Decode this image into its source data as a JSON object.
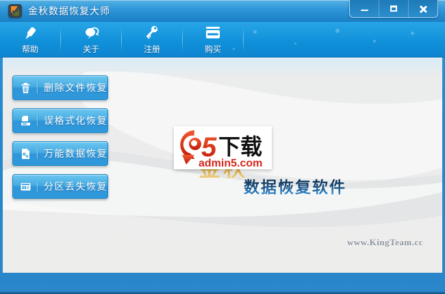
{
  "window": {
    "title": "金秋数据恢复大师",
    "controls": [
      {
        "name": "minimize"
      },
      {
        "name": "maximize"
      },
      {
        "name": "close"
      }
    ]
  },
  "toolbar": {
    "items": [
      {
        "label": "帮助",
        "icon": "pen-icon"
      },
      {
        "label": "关于",
        "icon": "chat-bubbles-icon"
      },
      {
        "label": "注册",
        "icon": "key-icon"
      },
      {
        "label": "购买",
        "icon": "bank-card-icon"
      }
    ]
  },
  "sidebar": {
    "items": [
      {
        "label": "删除文件恢复",
        "icon": "trash-icon"
      },
      {
        "label": "误格式化恢复",
        "icon": "format-disk-icon"
      },
      {
        "label": "万能数据恢复",
        "icon": "universal-recovery-icon"
      },
      {
        "label": "分区丢失恢复",
        "icon": "partition-icon"
      }
    ]
  },
  "main": {
    "watermark": {
      "five": "5",
      "download_text": "下载",
      "site": "admin5.com"
    },
    "brand_gold_text": "金秋",
    "tagline": "数据恢复软件",
    "website": "www.KingTeam.cc"
  },
  "colors": {
    "titlebar_blue": "#2d95d8",
    "toolbar_blue": "#1191da",
    "button_blue": "#45aae1",
    "frame_blue": "#2b86ca",
    "content_gray": "#ededec",
    "watermark_red": "#d5261a",
    "tagline_navy": "#16446e",
    "gold": "#d8a93f"
  }
}
